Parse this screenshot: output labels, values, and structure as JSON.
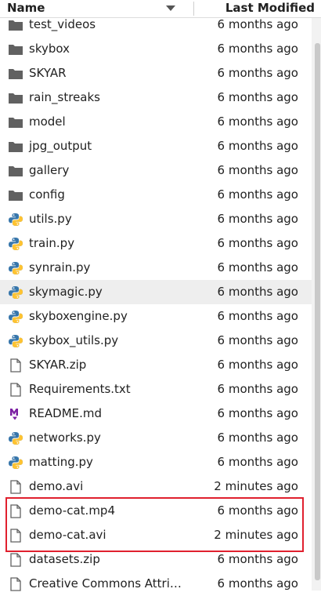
{
  "header": {
    "name_label": "Name",
    "modified_label": "Last Modified"
  },
  "files": [
    {
      "name": "test_videos",
      "modified": "6 months ago",
      "icon": "folder-icon"
    },
    {
      "name": "skybox",
      "modified": "6 months ago",
      "icon": "folder-icon"
    },
    {
      "name": "SKYAR",
      "modified": "6 months ago",
      "icon": "folder-icon"
    },
    {
      "name": "rain_streaks",
      "modified": "6 months ago",
      "icon": "folder-icon"
    },
    {
      "name": "model",
      "modified": "6 months ago",
      "icon": "folder-icon"
    },
    {
      "name": "jpg_output",
      "modified": "6 months ago",
      "icon": "folder-icon"
    },
    {
      "name": "gallery",
      "modified": "6 months ago",
      "icon": "folder-icon"
    },
    {
      "name": "config",
      "modified": "6 months ago",
      "icon": "folder-icon"
    },
    {
      "name": "utils.py",
      "modified": "6 months ago",
      "icon": "python-icon"
    },
    {
      "name": "train.py",
      "modified": "6 months ago",
      "icon": "python-icon"
    },
    {
      "name": "synrain.py",
      "modified": "6 months ago",
      "icon": "python-icon"
    },
    {
      "name": "skymagic.py",
      "modified": "6 months ago",
      "icon": "python-icon",
      "selected": true
    },
    {
      "name": "skyboxengine.py",
      "modified": "6 months ago",
      "icon": "python-icon"
    },
    {
      "name": "skybox_utils.py",
      "modified": "6 months ago",
      "icon": "python-icon"
    },
    {
      "name": "SKYAR.zip",
      "modified": "6 months ago",
      "icon": "file-icon"
    },
    {
      "name": "Requirements.txt",
      "modified": "6 months ago",
      "icon": "file-icon"
    },
    {
      "name": "README.md",
      "modified": "6 months ago",
      "icon": "markdown-icon"
    },
    {
      "name": "networks.py",
      "modified": "6 months ago",
      "icon": "python-icon"
    },
    {
      "name": "matting.py",
      "modified": "6 months ago",
      "icon": "python-icon"
    },
    {
      "name": "demo.avi",
      "modified": "2 minutes ago",
      "icon": "file-icon"
    },
    {
      "name": "demo-cat.mp4",
      "modified": "6 months ago",
      "icon": "file-icon"
    },
    {
      "name": "demo-cat.avi",
      "modified": "2 minutes ago",
      "icon": "file-icon"
    },
    {
      "name": "datasets.zip",
      "modified": "6 months ago",
      "icon": "file-icon"
    },
    {
      "name": "Creative Commons Attri…",
      "modified": "6 months ago",
      "icon": "file-icon"
    }
  ],
  "colors": {
    "folder": "#616161",
    "python_blue": "#3776ab",
    "python_yellow": "#ffc331",
    "markdown": "#7b1fa2",
    "highlight": "#e0202e",
    "selected_row": "#eeeeee"
  }
}
